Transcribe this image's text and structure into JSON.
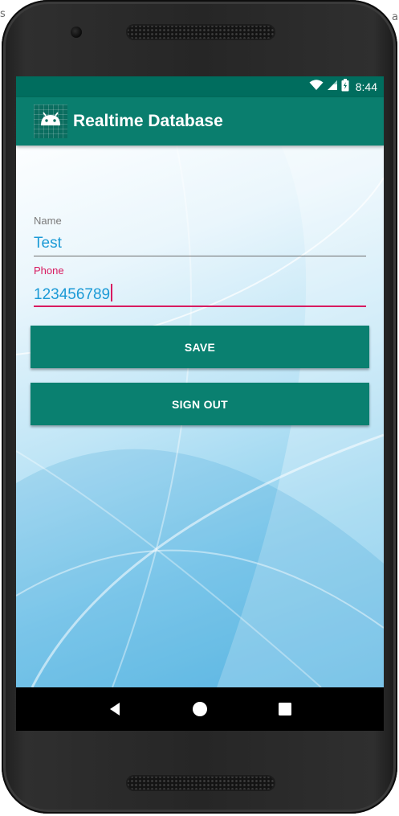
{
  "status_bar": {
    "time": "8:44",
    "icons": [
      "wifi-icon",
      "cell-signal-icon",
      "battery-icon"
    ]
  },
  "toolbar": {
    "title": "Realtime Database",
    "logo_icon": "android-icon"
  },
  "form": {
    "name_label": "Name",
    "name_value": "Test",
    "phone_label": "Phone",
    "phone_value": "123456789"
  },
  "buttons": {
    "save": "SAVE",
    "sign_out": "SIGN OUT"
  },
  "nav": {
    "icons": [
      "back-icon",
      "home-icon",
      "recents-icon"
    ]
  },
  "colors": {
    "primary_dark": "#006d5e",
    "primary": "#0a7e6e",
    "accent": "#d81b60",
    "input_text": "#1b9ad6"
  }
}
